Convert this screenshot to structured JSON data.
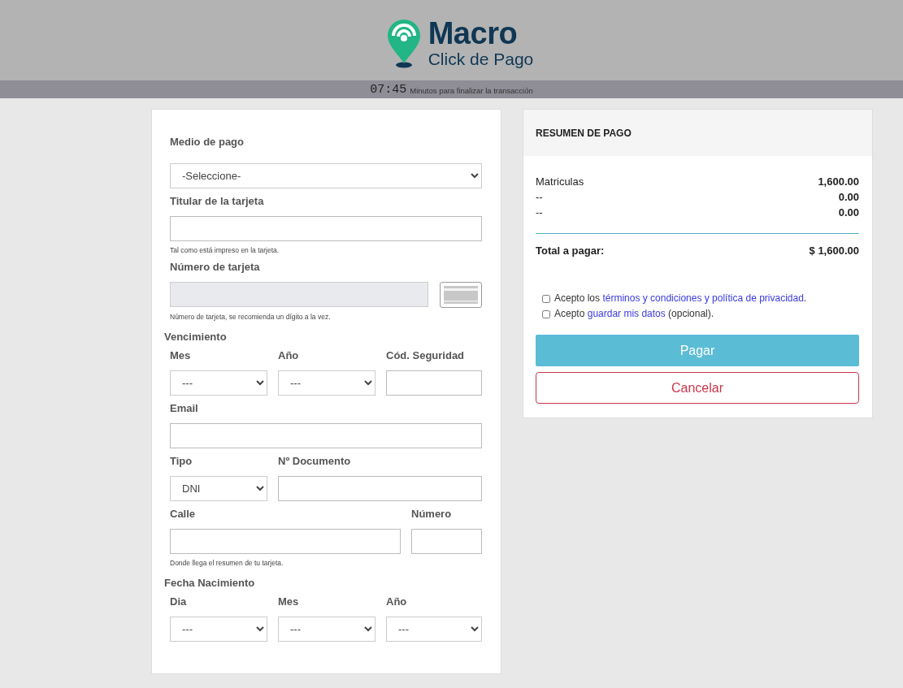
{
  "header": {
    "brand": "Macro",
    "tagline": "Click de Pago"
  },
  "timer": {
    "time": "07:45",
    "caption": "Minutos para finalizar la transacción"
  },
  "form": {
    "rows": [
      {
        "kind": "fields",
        "fields": [
          {
            "label": "Medio de pago",
            "kind": "select",
            "value": "-Seleccione-"
          }
        ]
      },
      {
        "kind": "fields",
        "fields": [
          {
            "label": "Titular de la tarjeta",
            "kind": "input"
          }
        ],
        "help": "Tal como está impreso en la tarjeta."
      },
      {
        "kind": "fields",
        "fields": [
          {
            "label": "Número de tarjeta",
            "kind": "card_number",
            "disabled": true
          }
        ],
        "help": "Número de tarjeta, se recomienda un dígito a la vez."
      },
      {
        "kind": "section",
        "title": "Vencimiento"
      },
      {
        "kind": "fields",
        "fields": [
          {
            "label": "Mes",
            "kind": "select",
            "value": "---"
          },
          {
            "label": "Año",
            "kind": "select",
            "value": "---"
          },
          {
            "label": "Cód. Seguridad",
            "kind": "input"
          }
        ]
      },
      {
        "kind": "fields",
        "fields": [
          {
            "label": "Email",
            "kind": "input"
          }
        ]
      },
      {
        "kind": "fields",
        "fields": [
          {
            "label": "Tipo",
            "kind": "select",
            "value": "DNI"
          },
          {
            "label": "Nº Documento",
            "kind": "input"
          }
        ]
      },
      {
        "kind": "fields",
        "fields": [
          {
            "label": "Calle",
            "kind": "input"
          },
          {
            "label": "Número",
            "kind": "input"
          }
        ],
        "help": "Donde llega el resumen de tu tarjeta."
      },
      {
        "kind": "section",
        "title": "Fecha Nacimiento"
      },
      {
        "kind": "fields",
        "fields": [
          {
            "label": "Dia",
            "kind": "select",
            "value": "---"
          },
          {
            "label": "Mes",
            "kind": "select",
            "value": "---"
          },
          {
            "label": "Año",
            "kind": "select",
            "value": "---"
          }
        ]
      }
    ]
  },
  "summary": {
    "title": "RESUMEN DE PAGO",
    "items": [
      {
        "name": "Matriculas",
        "amount": "1,600.00"
      },
      {
        "name": "--",
        "amount": "0.00"
      },
      {
        "name": "--",
        "amount": "0.00"
      }
    ],
    "total_label": "Total a pagar:",
    "total": "$ 1,600.00",
    "agreements": [
      {
        "checked": false,
        "parts": [
          {
            "kind": "text",
            "text": "Acepto los "
          },
          {
            "kind": "link",
            "text": "términos y condiciones y política de privacidad"
          },
          {
            "kind": "text",
            "text": "."
          }
        ]
      },
      {
        "checked": false,
        "parts": [
          {
            "kind": "text",
            "text": "Acepto "
          },
          {
            "kind": "link",
            "text": "guardar mis datos"
          },
          {
            "kind": "text",
            "text": " (opcional)."
          }
        ]
      }
    ],
    "buttons": [
      {
        "kind": "primary",
        "label": "Pagar"
      },
      {
        "kind": "cancel",
        "label": "Cancelar"
      }
    ]
  }
}
